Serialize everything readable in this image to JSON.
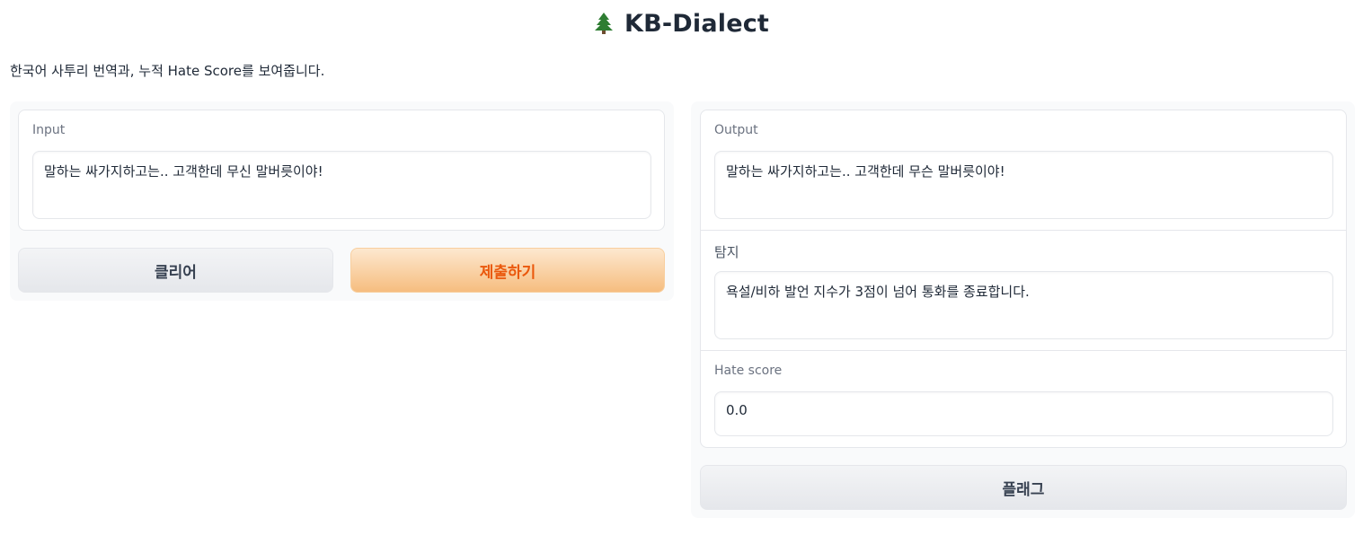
{
  "header": {
    "icon": "tree-icon",
    "title": "KB-Dialect",
    "description": "한국어 사투리 번역과, 누적 Hate Score를 보여줍니다."
  },
  "input_panel": {
    "label": "Input",
    "value": "말하는 싸가지하고는.. 고객한데 무신 말버릇이야!",
    "clear_button": "클리어",
    "submit_button": "제출하기"
  },
  "output_panel": {
    "output_label": "Output",
    "output_value": "말하는 싸가지하고는.. 고객한데 무슨 말버릇이야!",
    "detect_label": "탐지",
    "detect_value": "욕설/비하 발언 지수가 3점이 넘어 통화를 종료합니다.",
    "score_label": "Hate score",
    "score_value": "0.0",
    "flag_button": "플래그"
  },
  "colors": {
    "accent": "#ea580c",
    "primary_button_top": "#fde8cf",
    "primary_button_bottom": "#f6bd7f",
    "tree": "#2e7d32"
  }
}
